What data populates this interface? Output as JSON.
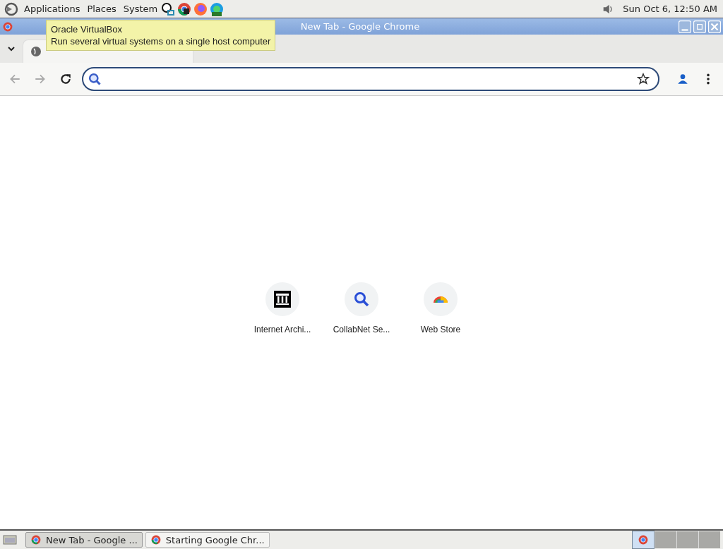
{
  "top_panel": {
    "menus": [
      "Applications",
      "Places",
      "System"
    ],
    "clock": "Sun Oct  6, 12:50 AM"
  },
  "tooltip": {
    "title": "Oracle VirtualBox",
    "description": "Run several virtual systems on a single host computer"
  },
  "window": {
    "title": "New Tab - Google Chrome"
  },
  "shortcuts": [
    {
      "label": "Internet Archi...",
      "kind": "archive"
    },
    {
      "label": "CollabNet Se...",
      "kind": "search"
    },
    {
      "label": "Web Store",
      "kind": "store"
    }
  ],
  "taskbar": {
    "buttons": [
      {
        "label": "New Tab - Google ...",
        "selected": true
      },
      {
        "label": "Starting Google Chr...",
        "selected": false
      }
    ],
    "workspaces": [
      {
        "selected": true
      },
      {
        "selected": false
      },
      {
        "selected": false
      },
      {
        "selected": false
      }
    ]
  }
}
